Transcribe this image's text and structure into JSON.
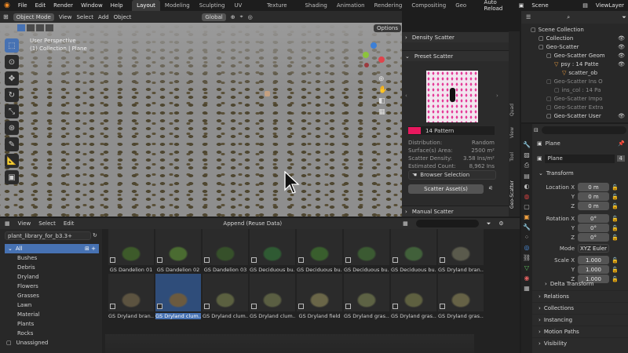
{
  "topbar": {
    "menus": [
      "File",
      "Edit",
      "Render",
      "Window",
      "Help"
    ],
    "workspaces": [
      "Layout",
      "Modeling",
      "Sculpting",
      "UV Editing",
      "Texture Paint",
      "Shading",
      "Animation",
      "Rendering",
      "Compositing",
      "Geo"
    ],
    "auto_reload": "Auto Reload",
    "scene": "Scene",
    "view_layer": "ViewLayer"
  },
  "viewport": {
    "mode": "Object Mode",
    "menus": [
      "View",
      "Select",
      "Add",
      "Object"
    ],
    "orientation": "Global",
    "options": "Options",
    "overlay_line1": "User Perspective",
    "overlay_line2": "(1) Collection | Plane"
  },
  "scatter": {
    "density_title": "Density Scatter",
    "preset_title": "Preset Scatter",
    "pattern_name": "14 Pattern",
    "stats": [
      {
        "label": "Distribution:",
        "value": "Random"
      },
      {
        "label": "Surface(s) Area:",
        "value": "2500 m²"
      },
      {
        "label": "Scatter Density:",
        "value": "3.58 Ins/m²"
      },
      {
        "label": "Estimated Count:",
        "value": "8,962 Ins"
      }
    ],
    "browser_selection": "Browser Selection",
    "scatter_assets": "Scatter Asset(s)",
    "manual_title": "Manual Scatter",
    "side_tabs": [
      "Quad",
      "View",
      "Tool",
      "Geo-Scatter"
    ],
    "pattern_color": "#e8185e"
  },
  "outliner": {
    "items": [
      {
        "label": "Scene Collection",
        "dim": false,
        "indent": 0
      },
      {
        "label": "Collection",
        "dim": false,
        "indent": 1
      },
      {
        "label": "Geo-Scatter",
        "dim": false,
        "indent": 1
      },
      {
        "label": "Geo-Scatter Geom",
        "dim": false,
        "indent": 2
      },
      {
        "label": "psy : 14 Patte",
        "dim": false,
        "indent": 3
      },
      {
        "label": "scatter_ob",
        "dim": false,
        "indent": 4
      },
      {
        "label": "Geo-Scatter Ins O",
        "dim": true,
        "indent": 2
      },
      {
        "label": "ins_col : 14 Pa",
        "dim": true,
        "indent": 3
      },
      {
        "label": "Geo-Scatter Impo",
        "dim": true,
        "indent": 2
      },
      {
        "label": "Geo-Scatter Extra",
        "dim": true,
        "indent": 2
      },
      {
        "label": "Geo-Scatter User",
        "dim": false,
        "indent": 2
      }
    ]
  },
  "asset_browser": {
    "menus": [
      "View",
      "Select",
      "Edit"
    ],
    "append": "Append (Reuse Data)",
    "library": "plant_library_for_b3.3+",
    "categories": [
      "All",
      "Bushes",
      "Debris",
      "Dryland",
      "Flowers",
      "Grasses",
      "Lawn",
      "Material",
      "Plants",
      "Rocks",
      "Unassigned"
    ],
    "assets_row1": [
      "GS Dandelion 01",
      "GS Dandelion 02",
      "GS Dandelion 03",
      "GS Deciduous bu...",
      "GS Deciduous bu...",
      "GS Deciduous bu...",
      "GS Deciduous bu...",
      "GS Dryland bran..."
    ],
    "assets_row2": [
      "GS Dryland bran...",
      "GS Dryland clum...",
      "GS Dryland clum...",
      "GS Dryland clum...",
      "GS Dryland field",
      "GS Dryland gras...",
      "GS Dryland gras...",
      "GS Dryland gras..."
    ],
    "selected_index": 1
  },
  "properties": {
    "object": "Plane",
    "data_name": "Plane",
    "users": "4",
    "transform": "Transform",
    "location": {
      "label": "Location X",
      "x": "0 m",
      "y": "0 m",
      "z": "0 m"
    },
    "rotation": {
      "label": "Rotation X",
      "x": "0°",
      "y": "0°",
      "z": "0°"
    },
    "mode_label": "Mode",
    "mode": "XYZ Euler",
    "scale": {
      "label": "Scale X",
      "x": "1.000",
      "y": "1.000",
      "z": "1.000"
    },
    "axis": {
      "y": "Y",
      "z": "Z"
    },
    "delta": "Delta Transform",
    "sections": [
      "Relations",
      "Collections",
      "Instancing",
      "Motion Paths",
      "Visibility"
    ]
  }
}
